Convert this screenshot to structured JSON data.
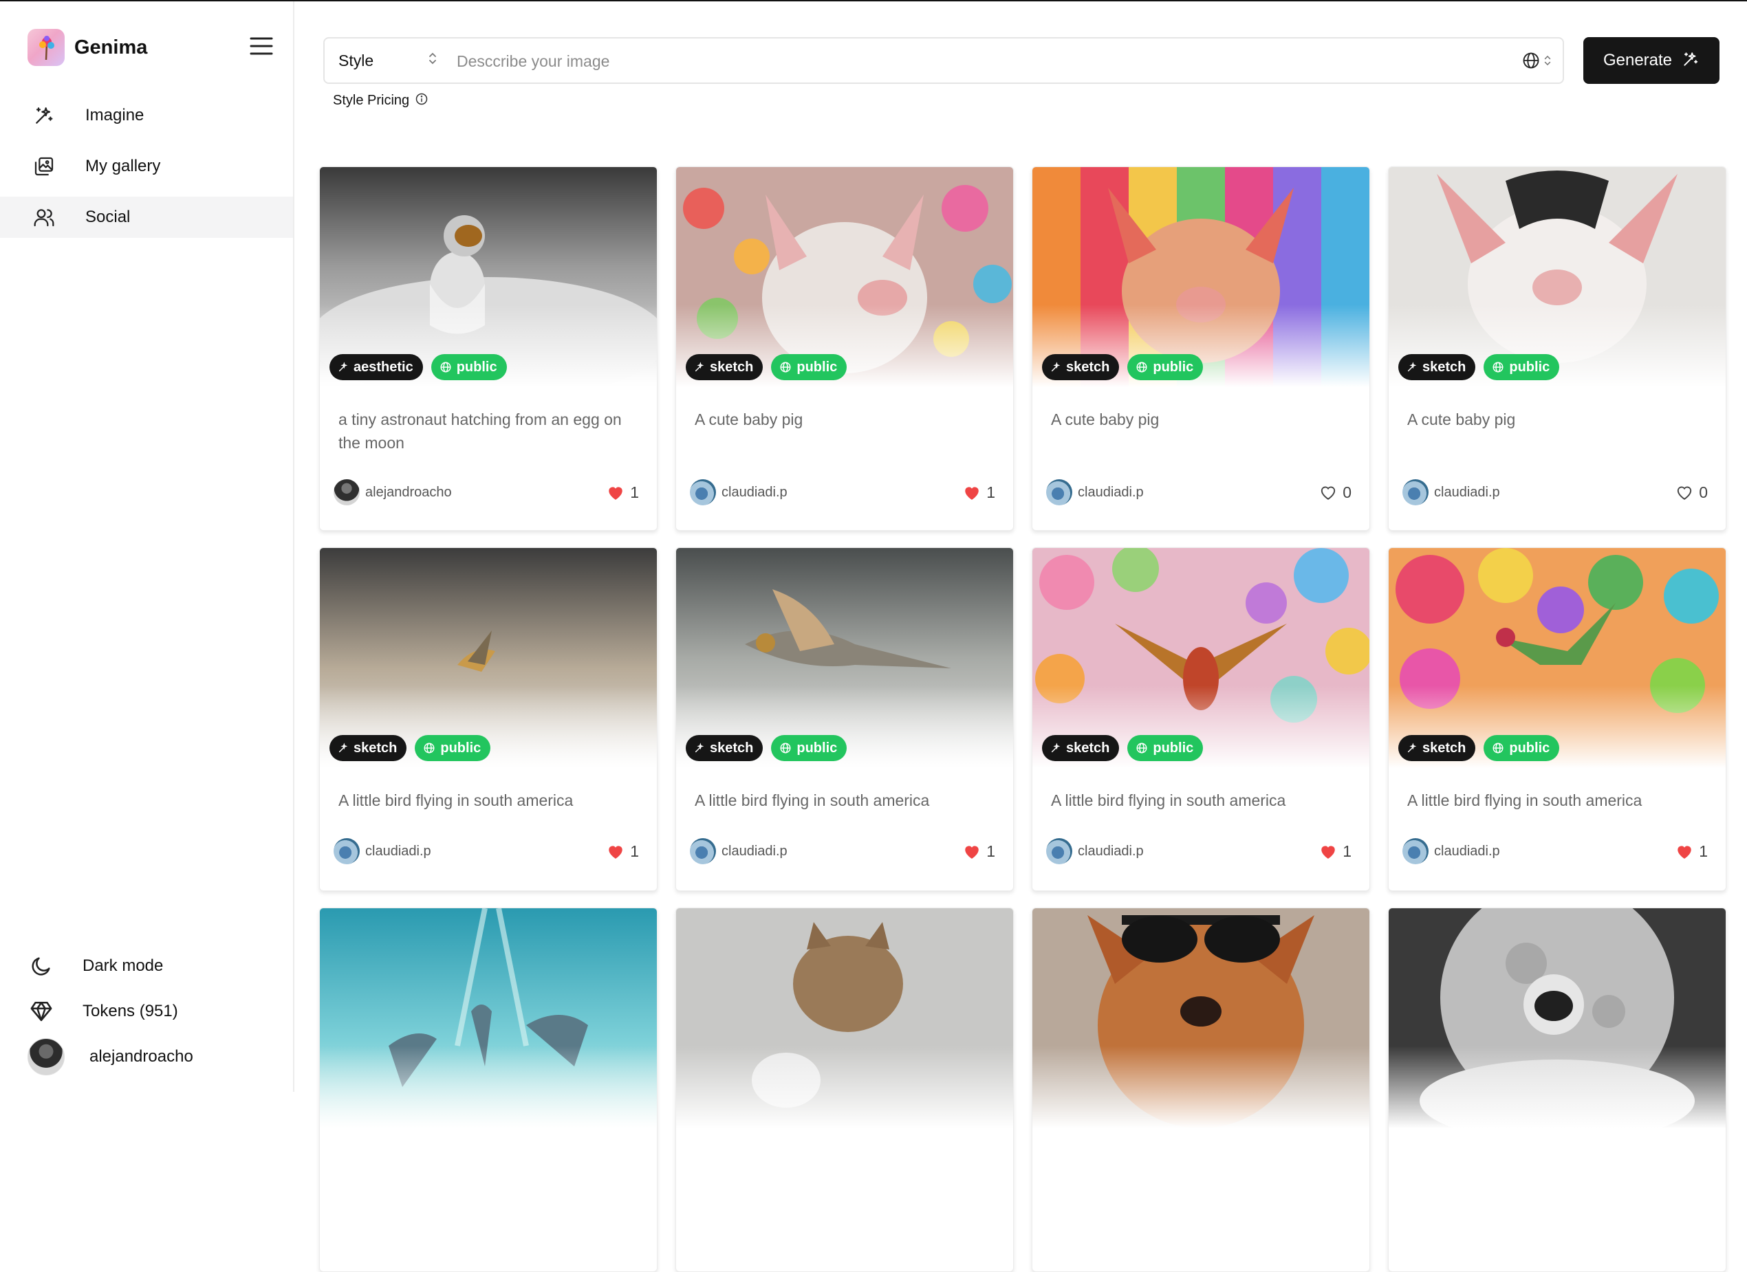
{
  "app": {
    "name": "Genima"
  },
  "sidebar": {
    "nav": [
      {
        "label": "Imagine",
        "icon": "sparkles-icon"
      },
      {
        "label": "My gallery",
        "icon": "gallery-icon"
      },
      {
        "label": "Social",
        "icon": "users-icon",
        "active": true
      }
    ],
    "bottom": {
      "dark_mode": "Dark mode",
      "tokens": "Tokens (951)",
      "username": "alejandroacho"
    }
  },
  "topbar": {
    "style_label": "Style",
    "prompt_placeholder": "Desccribe your image",
    "generate_label": "Generate",
    "pricing_label": "Style Pricing"
  },
  "colors": {
    "public": "#22c55e",
    "dark": "#161616",
    "heart": "#ef4444"
  },
  "cards": [
    {
      "prompt": "a tiny astronaut hatching from an egg on the moon",
      "style": "aesthetic",
      "visibility": "public",
      "author": "alejandroacho",
      "likes": "1",
      "liked": true
    },
    {
      "prompt": "A cute baby pig",
      "style": "sketch",
      "visibility": "public",
      "author": "claudiadi.p",
      "likes": "1",
      "liked": true
    },
    {
      "prompt": "A cute baby pig",
      "style": "sketch",
      "visibility": "public",
      "author": "claudiadi.p",
      "likes": "0",
      "liked": false
    },
    {
      "prompt": "A cute baby pig",
      "style": "sketch",
      "visibility": "public",
      "author": "claudiadi.p",
      "likes": "0",
      "liked": false
    },
    {
      "prompt": "A little bird flying in south america",
      "style": "sketch",
      "visibility": "public",
      "author": "claudiadi.p",
      "likes": "1",
      "liked": true
    },
    {
      "prompt": "A little bird flying in south america",
      "style": "sketch",
      "visibility": "public",
      "author": "claudiadi.p",
      "likes": "1",
      "liked": true
    },
    {
      "prompt": "A little bird flying in south america",
      "style": "sketch",
      "visibility": "public",
      "author": "claudiadi.p",
      "likes": "1",
      "liked": true
    },
    {
      "prompt": "A little bird flying in south america",
      "style": "sketch",
      "visibility": "public",
      "author": "claudiadi.p",
      "likes": "1",
      "liked": true
    }
  ]
}
